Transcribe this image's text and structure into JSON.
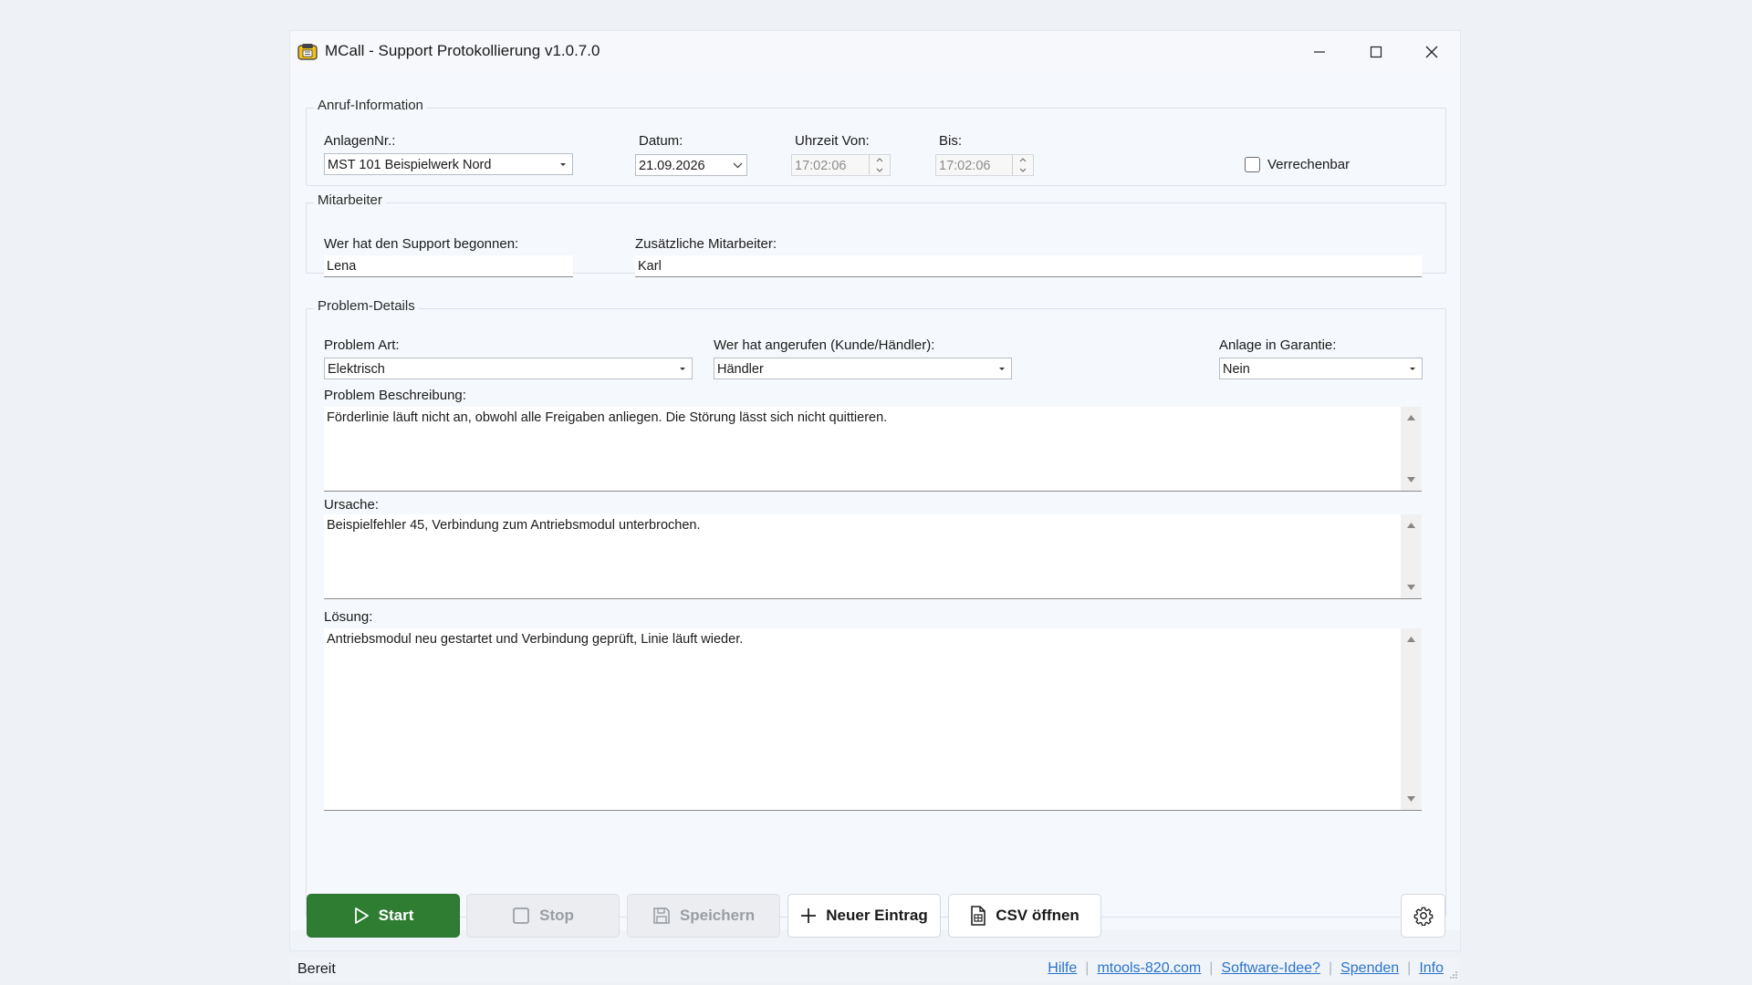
{
  "window": {
    "title": "MCall - Support Protokollierung  v1.0.7.0"
  },
  "anruf": {
    "group_label": "Anruf-Information",
    "anlagen_label": "AnlagenNr.:",
    "anlagen_value": "MST 101 Beispielwerk Nord",
    "datum_label": "Datum:",
    "datum_value": "21.09.2026",
    "von_label": "Uhrzeit Von:",
    "von_value": "17:02:06",
    "bis_label": "Bis:",
    "bis_value": "17:02:06",
    "verrechenbar_label": "Verrechenbar",
    "verrechenbar_checked": false
  },
  "mitarbeiter": {
    "group_label": "Mitarbeiter",
    "begonnen_label": "Wer hat den Support begonnen:",
    "begonnen_value": "Lena",
    "zusaetzlich_label": "Zusätzliche Mitarbeiter:",
    "zusaetzlich_value": "Karl"
  },
  "problem": {
    "group_label": "Problem-Details",
    "art_label": "Problem Art:",
    "art_value": "Elektrisch",
    "anrufer_label": "Wer hat angerufen (Kunde/Händler):",
    "anrufer_value": "Händler",
    "garantie_label": "Anlage in Garantie:",
    "garantie_value": "Nein",
    "beschreibung_label": "Problem Beschreibung:",
    "beschreibung_value": "Förderlinie läuft nicht an, obwohl alle Freigaben anliegen. Die Störung lässt sich nicht quittieren.",
    "ursache_label": "Ursache:",
    "ursache_value": "Beispielfehler 45, Verbindung zum Antriebsmodul unterbrochen.",
    "loesung_label": "Lösung:",
    "loesung_value": "Antriebsmodul neu gestartet und Verbindung geprüft, Linie läuft wieder."
  },
  "buttons": {
    "start": "Start",
    "stop": "Stop",
    "speichern": "Speichern",
    "neuer_eintrag": "Neuer Eintrag",
    "csv_oeffnen": "CSV öffnen"
  },
  "statusbar": {
    "status": "Bereit",
    "links": [
      "Hilfe",
      "mtools-820.com",
      "Software-Idee?",
      "Spenden",
      "Info"
    ]
  },
  "colors": {
    "primary": "#2e7d32",
    "link": "#2a73c9"
  }
}
